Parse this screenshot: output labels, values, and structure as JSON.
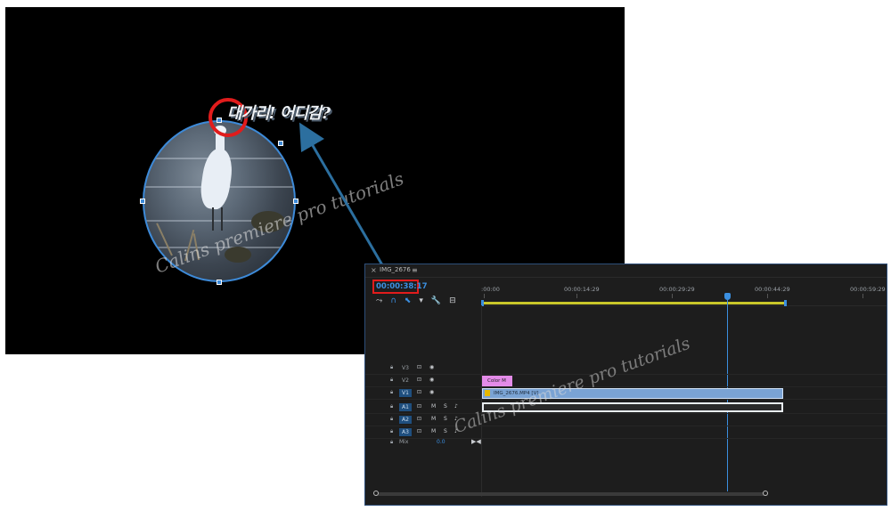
{
  "preview": {
    "caption": "대가리! 어디감?",
    "watermark": "Calins premiere pro tutorials"
  },
  "timeline": {
    "close_icon": "×",
    "sequence_tab": "IMG_2676",
    "menu_icon": "≡",
    "timecode": "00:00:38:17",
    "ruler_labels": [
      ":00:00",
      "00:00:14:29",
      "00:00:29:29",
      "00:00:44:29",
      "00:00:59:29"
    ],
    "tracks": [
      {
        "label": "V3",
        "controls": [
          "⊡",
          "◉"
        ]
      },
      {
        "label": "V2",
        "controls": [
          "⊡",
          "◉"
        ]
      },
      {
        "label": "V1",
        "controls": [
          "⊡",
          "◉"
        ]
      },
      {
        "label": "A1",
        "controls": [
          "⊡",
          "M",
          "S",
          "♪"
        ]
      },
      {
        "label": "A2",
        "controls": [
          "⊡",
          "M",
          "S",
          "♪"
        ]
      },
      {
        "label": "A3",
        "controls": [
          "⊡",
          "M",
          "S",
          "♪"
        ]
      }
    ],
    "mix_label": "Mix",
    "mix_value": "0.0",
    "mix_end_icon": "▶◀",
    "clip_color_label": "Color M",
    "clip_video_label": "IMG_2676.MP4 [V]",
    "watermark": "Calins premiere pro tutorials",
    "tools": [
      "⤳",
      "∩",
      "⬉",
      "▾",
      "🔧",
      "⊟"
    ]
  },
  "colors": {
    "accent": "#3b8fe0",
    "highlight_ring": "#e11c1c",
    "clip_color_matte": "#e38be8",
    "clip_video": "#7aa3d4",
    "workbar": "#c9c72a",
    "arrow": "#2c6f9f"
  }
}
